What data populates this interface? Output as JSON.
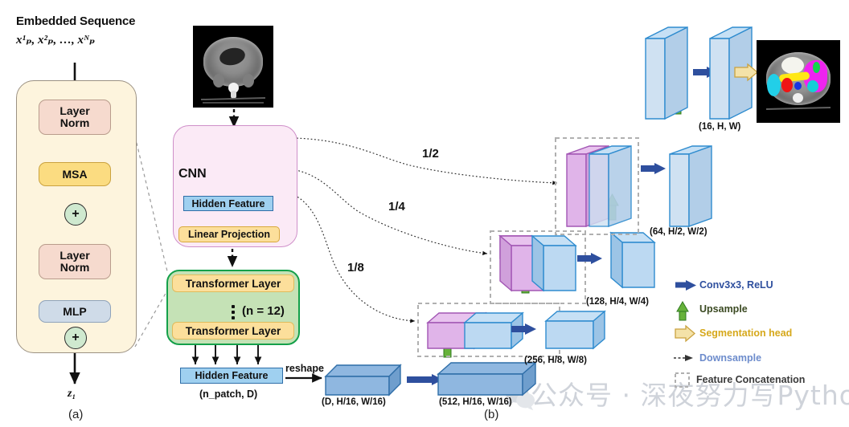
{
  "figure": {
    "panel_a_id": "(a)",
    "panel_b_id": "(b)"
  },
  "encoder_block": {
    "title": "Embedded Sequence",
    "sequence": "x¹ₚ, x²ₚ, …, xᴺₚ",
    "layer_norm_1": "Layer\nNorm",
    "msa": "MSA",
    "layer_norm_2": "Layer\nNorm",
    "mlp": "MLP",
    "add_1": "+",
    "add_2": "+",
    "output": "z₁"
  },
  "cnn_block": {
    "label": "CNN",
    "hidden_feature": "Hidden Feature",
    "linear_projection": "Linear Projection"
  },
  "transformer_block": {
    "layer_top": "Transformer Layer",
    "layer_bottom": "Transformer Layer",
    "repeat": "(n = 12)",
    "hidden_feature": "Hidden Feature",
    "hidden_feature_dims": "(n_patch, D)",
    "reshape": "reshape"
  },
  "skip_labels": {
    "half": "1/2",
    "quarter": "1/4",
    "eighth": "1/8"
  },
  "feature_dims": {
    "reshaped": "(D, H/16, W/16)",
    "bottleneck": "(512, H/16, W/16)",
    "level_8": "(256, H/8, W/8)",
    "level_4": "(128, H/4, W/4)",
    "level_2": "(64, H/2, W/2)",
    "level_1": "(16, H, W)"
  },
  "legend": {
    "title": "",
    "items": [
      {
        "icon": "conv-arrow-icon",
        "label": "Conv3x3, ReLU",
        "color": "#2e4f9e"
      },
      {
        "icon": "upsample-arrow-icon",
        "label": "Upsample",
        "color": "#4f9b28"
      },
      {
        "icon": "segmentation-arrow-icon",
        "label": "Segmentation head",
        "color": "#d6a81b"
      },
      {
        "icon": "downsample-arrow-icon",
        "label": "Downsample",
        "color": "#6d8ccc"
      },
      {
        "icon": "feature-concat-icon",
        "label": "Feature Concatenation",
        "color": "#8c8c8c"
      }
    ]
  },
  "watermark": {
    "text": "公众号 · 深夜努力写Python"
  },
  "colors": {
    "layer_norm": "#f6dace",
    "msa": "#fbdc81",
    "mlp": "#cfdbe8",
    "encoder_bg": "#fdf4dd",
    "cnn_bg": "#fbeaf6",
    "cnn_slab": "#d4aedd",
    "transformer_bg": "#c5e2b6",
    "transformer_layer": "#fcdf9b",
    "hidden_feature": "#9fd0f0",
    "conv_arrow": "#2e4f9e",
    "upsample_arrow": "#4f9b28",
    "seg_arrow": "#f1d88a",
    "feature_blue": "#bcd9f2",
    "feature_purple": "#e3b8e8"
  }
}
